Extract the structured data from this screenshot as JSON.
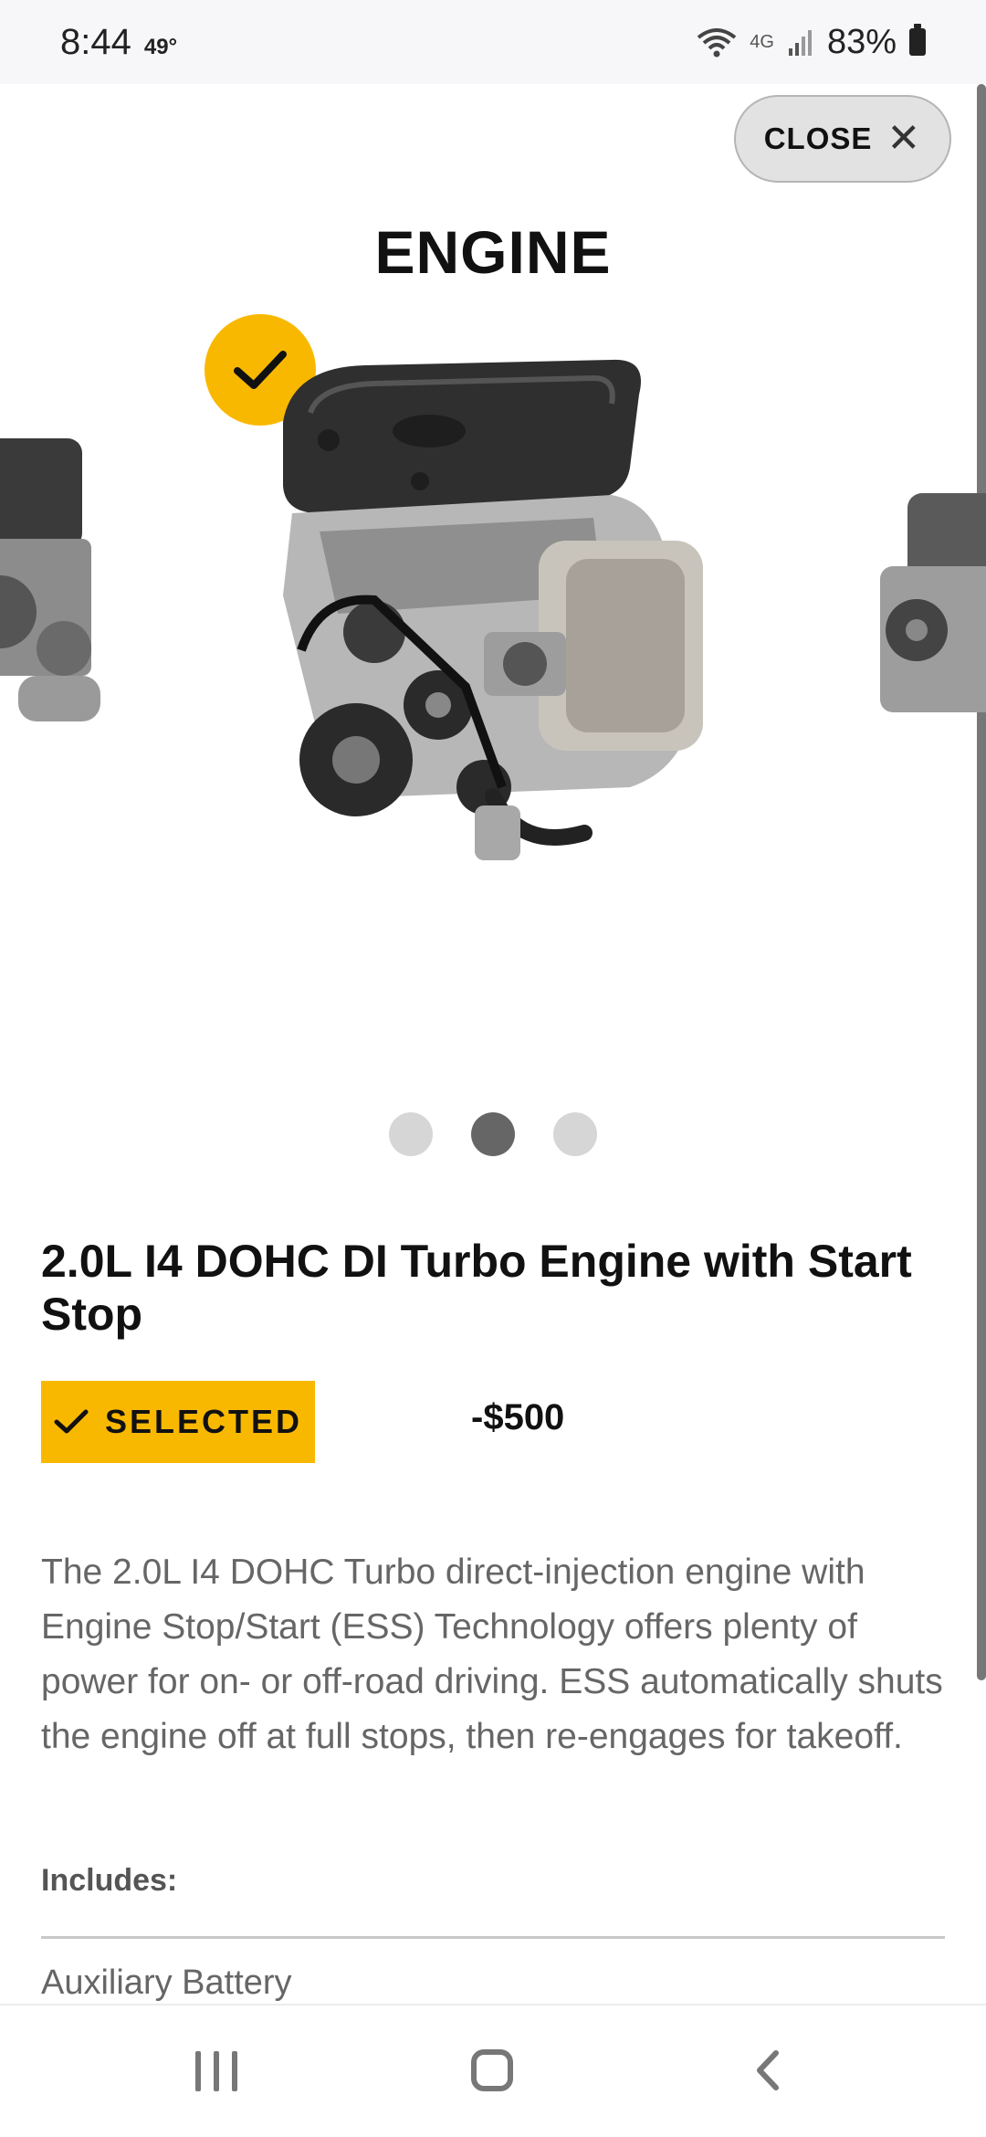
{
  "status_bar": {
    "time": "8:44",
    "temperature": "49°",
    "network": "4G",
    "battery": "83%"
  },
  "header": {
    "close_label": "CLOSE",
    "section_title": "ENGINE"
  },
  "carousel": {
    "total_slides": 3,
    "active_slide": 2,
    "selected_badge_icon": "checkmark-icon"
  },
  "option": {
    "title": "2.0L I4 DOHC DI Turbo Engine with Start Stop",
    "selected_label": "SELECTED",
    "price": "-$500",
    "description": "The 2.0L I4 DOHC Turbo direct-injection engine with Engine Stop/Start (ESS) Technology offers plenty of power for on- or off-road driving. ESS automatically shuts the engine off at full stops, then re-engages for takeoff.",
    "includes_label": "Includes:",
    "includes": [
      "Auxiliary Battery"
    ]
  },
  "colors": {
    "accent": "#f9b800",
    "dot_active": "#666666",
    "dot_inactive": "#d6d6d6"
  }
}
